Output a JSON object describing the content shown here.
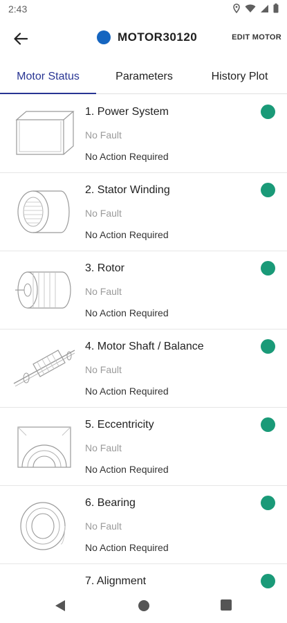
{
  "status_bar": {
    "time": "2:43"
  },
  "app_bar": {
    "title": "MOTOR30120",
    "edit_label": "EDIT MOTOR",
    "title_dot_color": "#1565c0"
  },
  "tabs": [
    {
      "label": "Motor Status",
      "active": true
    },
    {
      "label": "Parameters",
      "active": false
    },
    {
      "label": "History Plot",
      "active": false
    }
  ],
  "components": [
    {
      "title": "1. Power System",
      "fault": "No Fault",
      "action": "No Action Required",
      "status_color": "#1a9a78",
      "icon": "power-system-icon"
    },
    {
      "title": "2. Stator Winding",
      "fault": "No Fault",
      "action": "No Action Required",
      "status_color": "#1a9a78",
      "icon": "stator-winding-icon"
    },
    {
      "title": "3. Rotor",
      "fault": "No Fault",
      "action": "No Action Required",
      "status_color": "#1a9a78",
      "icon": "rotor-icon"
    },
    {
      "title": "4. Motor Shaft / Balance",
      "fault": "No Fault",
      "action": "No Action Required",
      "status_color": "#1a9a78",
      "icon": "motor-shaft-icon"
    },
    {
      "title": "5. Eccentricity",
      "fault": "No Fault",
      "action": "No Action Required",
      "status_color": "#1a9a78",
      "icon": "eccentricity-icon"
    },
    {
      "title": "6. Bearing",
      "fault": "No Fault",
      "action": "No Action Required",
      "status_color": "#1a9a78",
      "icon": "bearing-icon"
    },
    {
      "title": "7. Alignment",
      "fault": "",
      "action": "",
      "status_color": "#1a9a78",
      "icon": "alignment-icon"
    }
  ],
  "nav_bar": {
    "back": "back-triangle-icon",
    "home": "home-circle-icon",
    "recents": "recents-square-icon"
  }
}
